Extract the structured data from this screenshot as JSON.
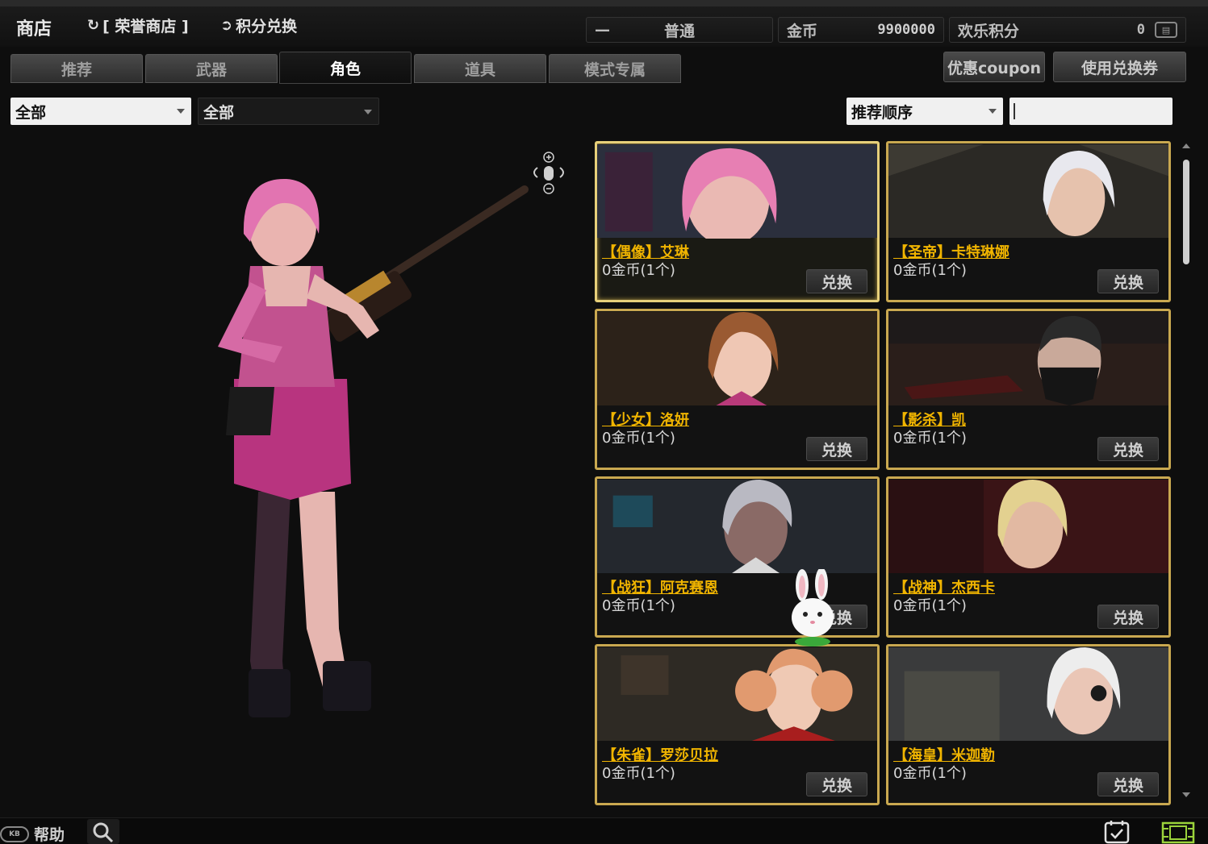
{
  "header": {
    "shop_title": "商店",
    "honor_shop": "[ 荣誉商店 ]",
    "points_exchange": "积分兑换",
    "mode_minus": "—",
    "mode_label": "普通",
    "gold_label": "金币",
    "gold_value": "9900000",
    "points_label": "欢乐积分",
    "points_value": "0"
  },
  "tabs": [
    {
      "label": "推荐"
    },
    {
      "label": "武器"
    },
    {
      "label": "角色"
    },
    {
      "label": "道具"
    },
    {
      "label": "模式专属"
    }
  ],
  "active_tab": "角色",
  "actions": {
    "coupon": "优惠coupon",
    "use_voucher": "使用兑换券"
  },
  "filters": {
    "category": "全部",
    "subcategory": "全部",
    "sort": "推荐顺序",
    "search_value": ""
  },
  "items": [
    {
      "name": "【偶像】艾琳",
      "price": "0金币(1个)",
      "button": "兑换",
      "hair": "#e77fb3",
      "bg": "#2b2f3d"
    },
    {
      "name": "【圣帝】卡特琳娜",
      "price": "0金币(1个)",
      "button": "兑换",
      "hair": "#e8e8ee",
      "bg": "#3d3a33"
    },
    {
      "name": "【少女】洛妍",
      "price": "0金币(1个)",
      "button": "兑换",
      "hair": "#9a5a32",
      "bg": "#2c2219"
    },
    {
      "name": "【影杀】凯",
      "price": "0金币(1个)",
      "button": "兑换",
      "hair": "#2a2a2a",
      "bg": "#2a1e1a"
    },
    {
      "name": "【战狂】阿克赛恩",
      "price": "0金币(1个)",
      "button": "兑换",
      "hair": "#b9b9c2",
      "bg": "#24282e"
    },
    {
      "name": "【战神】杰西卡",
      "price": "0金币(1个)",
      "button": "兑换",
      "hair": "#e3d190",
      "bg": "#3a1416"
    },
    {
      "name": "【朱雀】罗莎贝拉",
      "price": "0金币(1个)",
      "button": "兑换",
      "hair": "#e19a6f",
      "bg": "#2e2a24"
    },
    {
      "name": "【海皇】米迦勒",
      "price": "0金币(1个)",
      "button": "兑换",
      "hair": "#ededed",
      "bg": "#3a3b3c"
    }
  ],
  "footer": {
    "help": "帮助",
    "kb_label": "KB"
  }
}
